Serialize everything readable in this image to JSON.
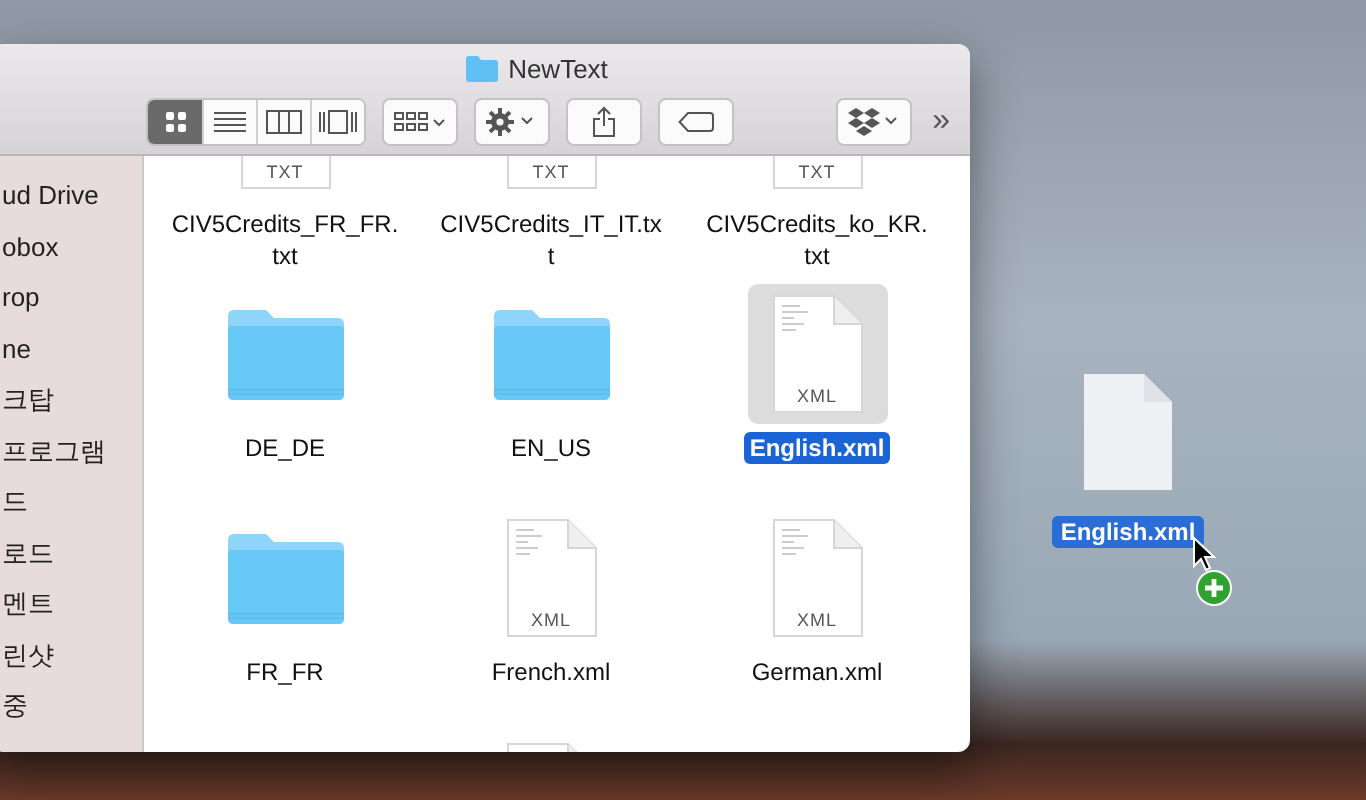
{
  "window": {
    "title": "NewText"
  },
  "toolbar": {
    "view_buttons": [
      {
        "kind": "icons",
        "selected": true
      },
      {
        "kind": "list",
        "selected": false
      },
      {
        "kind": "columns",
        "selected": false
      },
      {
        "kind": "coverflow",
        "selected": false
      }
    ],
    "overflow": "»"
  },
  "sidebar": {
    "items": [
      {
        "label": "ud Drive"
      },
      {
        "label": "obox"
      },
      {
        "label": "rop"
      },
      {
        "label": "ne"
      },
      {
        "label": "크탑"
      },
      {
        "label": "프로그램"
      },
      {
        "label": "드"
      },
      {
        "label": "로드"
      },
      {
        "label": "멘트"
      },
      {
        "label": "린샷"
      },
      {
        "label": "중"
      }
    ]
  },
  "files": [
    {
      "kind": "doc",
      "badge": "TXT",
      "name_lines": [
        "CIV5Credits_FR_FR.",
        "txt"
      ],
      "selected": false
    },
    {
      "kind": "doc",
      "badge": "TXT",
      "name_lines": [
        "CIV5Credits_IT_IT.tx",
        "t"
      ],
      "selected": false
    },
    {
      "kind": "doc",
      "badge": "TXT",
      "name_lines": [
        "CIV5Credits_ko_KR.",
        "txt"
      ],
      "selected": false
    },
    {
      "kind": "folder",
      "name_lines": [
        "DE_DE"
      ],
      "selected": false
    },
    {
      "kind": "folder",
      "name_lines": [
        "EN_US"
      ],
      "selected": false
    },
    {
      "kind": "doc",
      "badge": "XML",
      "name_lines": [
        "English.xml"
      ],
      "selected": true
    },
    {
      "kind": "folder",
      "name_lines": [
        "FR_FR"
      ],
      "selected": false
    },
    {
      "kind": "doc",
      "badge": "XML",
      "name_lines": [
        "French.xml"
      ],
      "selected": false
    },
    {
      "kind": "doc",
      "badge": "XML",
      "name_lines": [
        "German.xml"
      ],
      "selected": false
    },
    {
      "kind": "none"
    },
    {
      "kind": "doc"
    }
  ],
  "dragged_file": {
    "name": "English.xml"
  }
}
